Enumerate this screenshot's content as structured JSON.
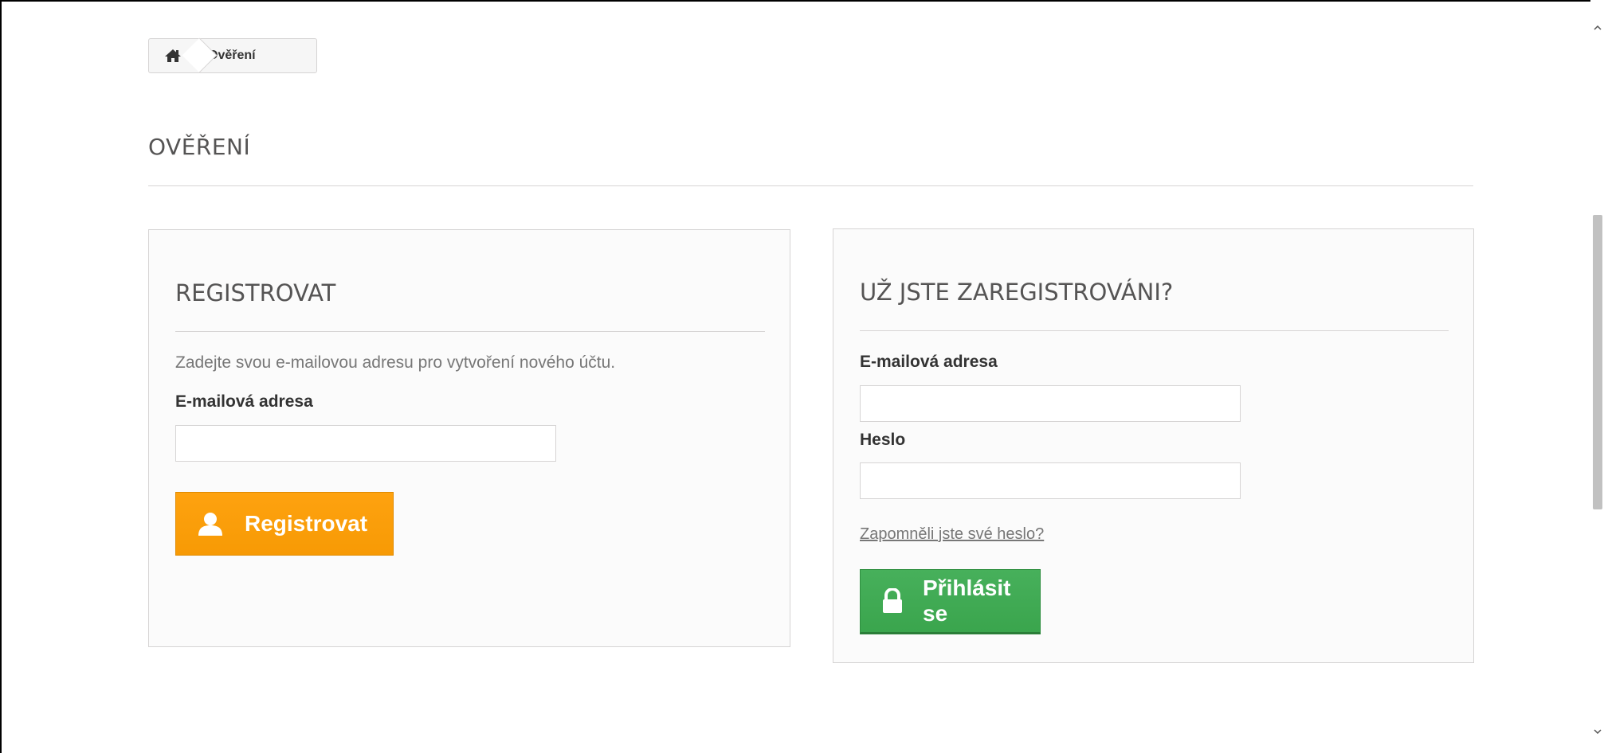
{
  "breadcrumb": {
    "current": "Ověření"
  },
  "page": {
    "heading": "OVĚŘENÍ"
  },
  "register": {
    "title": "REGISTROVAT",
    "description": "Zadejte svou e-mailovou adresu pro vytvoření nového účtu.",
    "email_label": "E-mailová adresa",
    "email_value": "",
    "button_label": "Registrovat",
    "button_color": "#f9a10a"
  },
  "login": {
    "title": "UŽ JSTE ZAREGISTROVÁNI?",
    "email_label": "E-mailová adresa",
    "email_value": "",
    "password_label": "Heslo",
    "password_value": "",
    "forgot_link": "Zapomněli jste své heslo?",
    "button_label": "Přihlásit se",
    "button_color": "#43ab55"
  },
  "icons": {
    "home": "home-icon",
    "user": "user-icon",
    "lock": "lock-icon"
  }
}
